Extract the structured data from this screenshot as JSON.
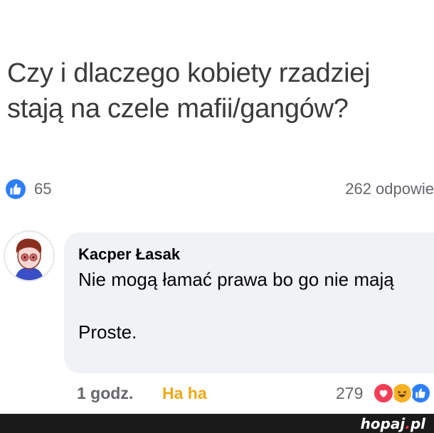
{
  "post": {
    "question": "Czy i dlaczego kobiety rzadziej stają na czele mafii/gangów?",
    "likes": "65",
    "answers": "262 odpowie"
  },
  "comment": {
    "author": "Kacper Łasak",
    "text": "Nie mogą łamać prawa bo go nie mają\n\nProste.",
    "time": "1 godz.",
    "reaction_label": "Ha ha",
    "reactions_count": "279",
    "reaction_icons": [
      "heart-icon",
      "haha-icon",
      "thumbs-up-icon"
    ]
  },
  "watermark": {
    "brand": "hopaj",
    "dot": ".",
    "tld": "pl"
  },
  "colors": {
    "like_blue": "#2d7ff9",
    "haha_label": "#f0a818",
    "heart_red": "#f33e58",
    "haha_yellow": "#f7b125",
    "bubble_bg": "#f0f2f5"
  }
}
